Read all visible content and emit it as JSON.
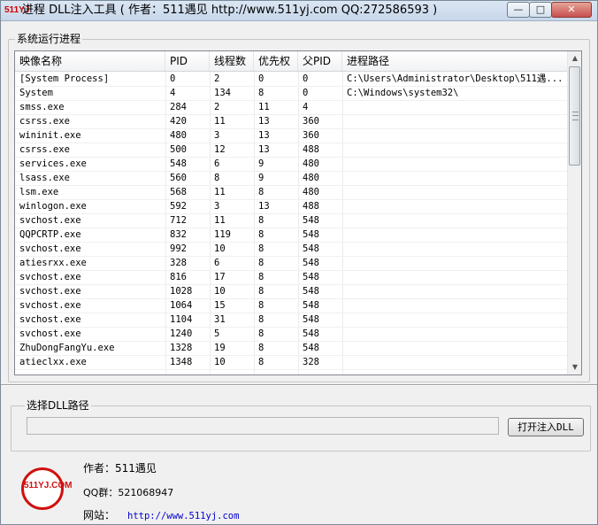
{
  "window": {
    "app_icon": "511YJ",
    "title": "进程 DLL注入工具 ( 作者：511遇见 http://www.511yj.com QQ:272586593 )",
    "controls": {
      "minimize": "—",
      "maximize": "□",
      "close": "✕"
    }
  },
  "process_group": {
    "label": "系统运行进程",
    "columns": [
      "映像名称",
      "PID",
      "线程数",
      "优先权",
      "父PID",
      "进程路径"
    ],
    "rows": [
      [
        "[System Process]",
        "0",
        "2",
        "0",
        "0",
        "C:\\Users\\Administrator\\Desktop\\511遇..."
      ],
      [
        "System",
        "4",
        "134",
        "8",
        "0",
        "C:\\Windows\\system32\\"
      ],
      [
        "smss.exe",
        "284",
        "2",
        "11",
        "4",
        ""
      ],
      [
        "csrss.exe",
        "420",
        "11",
        "13",
        "360",
        ""
      ],
      [
        "wininit.exe",
        "480",
        "3",
        "13",
        "360",
        ""
      ],
      [
        "csrss.exe",
        "500",
        "12",
        "13",
        "488",
        ""
      ],
      [
        "services.exe",
        "548",
        "6",
        "9",
        "480",
        ""
      ],
      [
        "lsass.exe",
        "560",
        "8",
        "9",
        "480",
        ""
      ],
      [
        "lsm.exe",
        "568",
        "11",
        "8",
        "480",
        ""
      ],
      [
        "winlogon.exe",
        "592",
        "3",
        "13",
        "488",
        ""
      ],
      [
        "svchost.exe",
        "712",
        "11",
        "8",
        "548",
        ""
      ],
      [
        "QQPCRTP.exe",
        "832",
        "119",
        "8",
        "548",
        ""
      ],
      [
        "svchost.exe",
        "992",
        "10",
        "8",
        "548",
        ""
      ],
      [
        "atiesrxx.exe",
        "328",
        "6",
        "8",
        "548",
        ""
      ],
      [
        "svchost.exe",
        "816",
        "17",
        "8",
        "548",
        ""
      ],
      [
        "svchost.exe",
        "1028",
        "10",
        "8",
        "548",
        ""
      ],
      [
        "svchost.exe",
        "1064",
        "15",
        "8",
        "548",
        ""
      ],
      [
        "svchost.exe",
        "1104",
        "31",
        "8",
        "548",
        ""
      ],
      [
        "svchost.exe",
        "1240",
        "5",
        "8",
        "548",
        ""
      ],
      [
        "ZhuDongFangYu.exe",
        "1328",
        "19",
        "8",
        "548",
        ""
      ],
      [
        "atieclxx.exe",
        "1348",
        "10",
        "8",
        "328",
        ""
      ]
    ],
    "scrollbar": {
      "up": "▲",
      "down": "▼"
    }
  },
  "dll_group": {
    "label": "选择DLL路径",
    "path_value": "",
    "button_label": "打开注入DLL"
  },
  "footer": {
    "logo_text": "511YJ.COM",
    "author_line": "作者：511遇见",
    "qq_line": "QQ群：521068947",
    "site_label": "网站：",
    "site_url": "http://www.511yj.com"
  }
}
